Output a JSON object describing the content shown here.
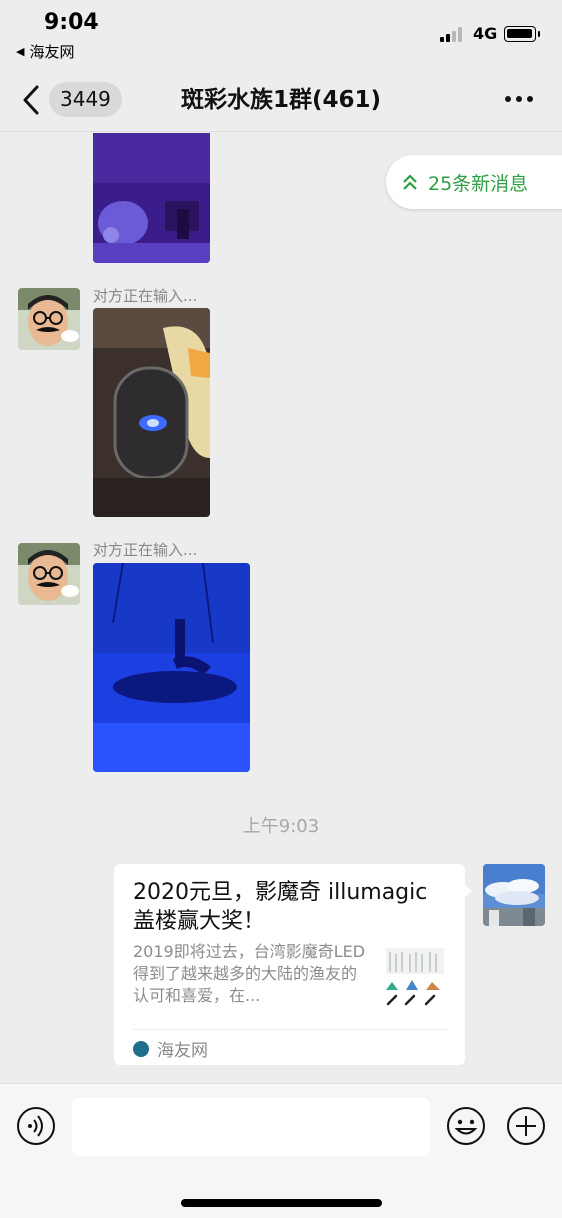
{
  "status_bar": {
    "time": "9:04",
    "back_app": "海友网",
    "network": "4G"
  },
  "nav": {
    "unread_count": "3449",
    "title": "斑彩水族1群(461)",
    "more_icon": "more-dots-icon"
  },
  "new_messages": {
    "label": "25条新消息"
  },
  "messages": [
    {
      "sender": "对方正在输入..."
    },
    {
      "sender": "对方正在输入..."
    }
  ],
  "time_divider": "上午9:03",
  "link_card": {
    "title": "2020元旦，影魔奇 illumagic 盖楼赢大奖！",
    "description": "2019即将过去，台湾影魔奇LED得到了越来越多的大陆的渔友的认可和喜爱，在...",
    "source": "海友网"
  },
  "colors": {
    "accent_green": "#2f9e44",
    "background": "#ededed"
  }
}
